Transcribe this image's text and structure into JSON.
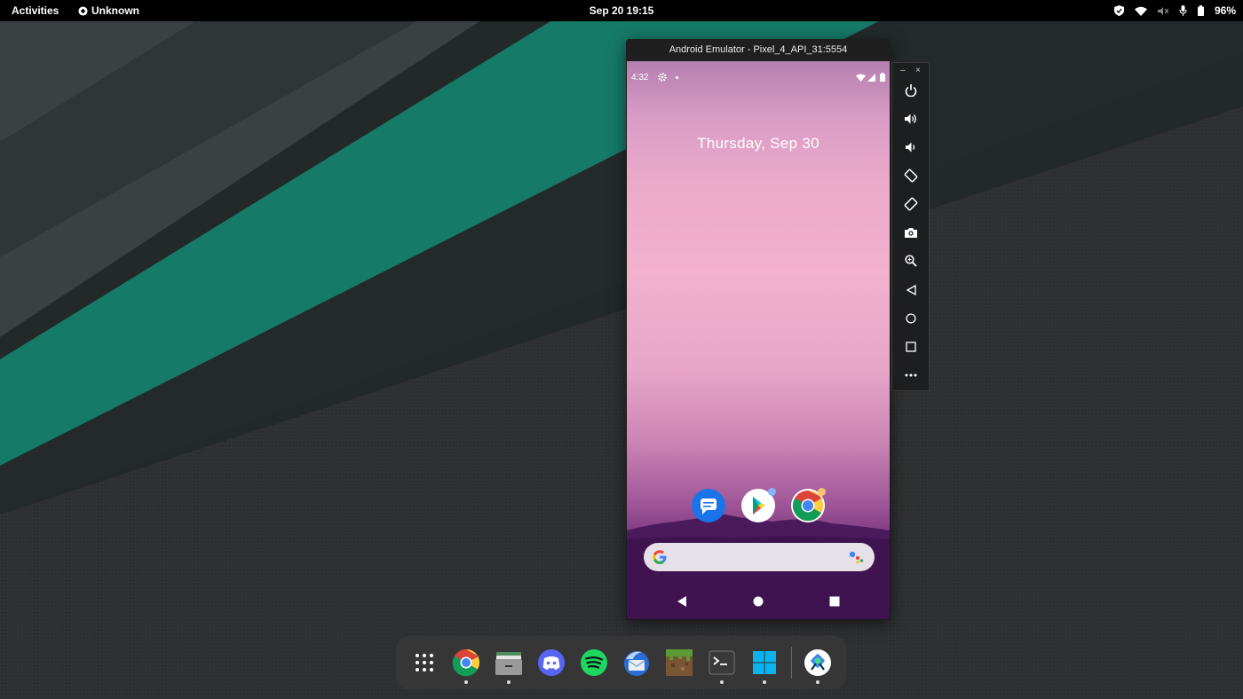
{
  "topbar": {
    "activities": "Activities",
    "app_name": "Unknown",
    "clock": "Sep 20  19:15",
    "battery": "96%"
  },
  "emulator": {
    "window_title": "Android Emulator - Pixel_4_API_31:5554",
    "status_time": "4:32",
    "date_widget": "Thursday, Sep 30",
    "home_apps": [
      "messages-icon",
      "play-store-icon",
      "chrome-icon"
    ],
    "toolbar": [
      "power-icon",
      "volume-up-icon",
      "volume-down-icon",
      "rotate-left-icon",
      "rotate-right-icon",
      "camera-icon",
      "zoom-icon",
      "back-icon",
      "home-icon",
      "overview-icon",
      "more-icon"
    ],
    "minimize": "–",
    "close": "×"
  },
  "dock": {
    "items": [
      "app-grid-icon",
      "chrome-icon",
      "files-icon",
      "discord-icon",
      "spotify-icon",
      "thunderbird-icon",
      "minecraft-icon",
      "terminal-icon",
      "windows-icon",
      "android-studio-icon"
    ],
    "running": [
      "chrome-icon",
      "files-icon",
      "terminal-icon",
      "windows-icon",
      "android-studio-icon"
    ]
  },
  "colors": {
    "wallpaper_green": "#157a66",
    "wallpaper_dark": "#24292a",
    "wallpaper_gray": "#2e2f31"
  }
}
